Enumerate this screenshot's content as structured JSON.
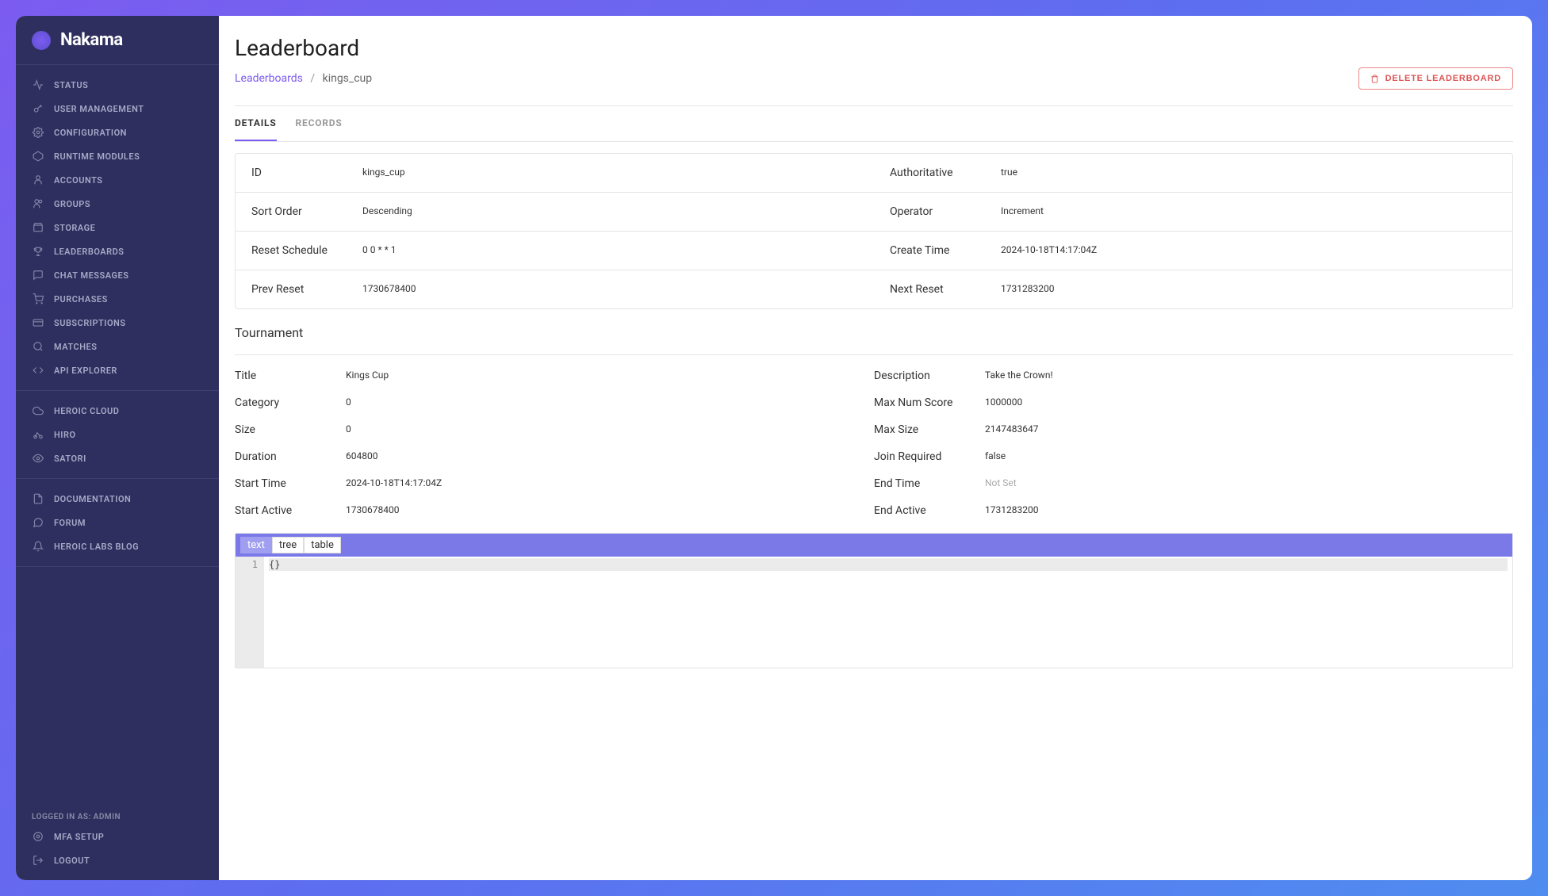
{
  "brand": "Nakama",
  "sidebar": {
    "main_items": [
      {
        "label": "Status",
        "icon": "activity"
      },
      {
        "label": "User Management",
        "icon": "key"
      },
      {
        "label": "Configuration",
        "icon": "gear"
      },
      {
        "label": "Runtime Modules",
        "icon": "hex"
      },
      {
        "label": "Accounts",
        "icon": "user"
      },
      {
        "label": "Groups",
        "icon": "users"
      },
      {
        "label": "Storage",
        "icon": "box"
      },
      {
        "label": "Leaderboards",
        "icon": "trophy"
      },
      {
        "label": "Chat Messages",
        "icon": "chat"
      },
      {
        "label": "Purchases",
        "icon": "cart"
      },
      {
        "label": "Subscriptions",
        "icon": "card"
      },
      {
        "label": "Matches",
        "icon": "flag"
      },
      {
        "label": "API Explorer",
        "icon": "code"
      }
    ],
    "product_items": [
      {
        "label": "Heroic Cloud",
        "icon": "cloud"
      },
      {
        "label": "Hiro",
        "icon": "bike"
      },
      {
        "label": "Satori",
        "icon": "eye"
      }
    ],
    "help_items": [
      {
        "label": "Documentation",
        "icon": "doc"
      },
      {
        "label": "Forum",
        "icon": "forum"
      },
      {
        "label": "Heroic Labs Blog",
        "icon": "bell"
      }
    ],
    "footer": {
      "logged_in": "Logged in as: admin",
      "mfa": "MFA Setup",
      "logout": "Logout"
    }
  },
  "page": {
    "title": "Leaderboard",
    "breadcrumb": {
      "parent": "Leaderboards",
      "current": "kings_cup"
    },
    "delete_button": "DELETE LEADERBOARD",
    "tabs": [
      {
        "label": "DETAILS",
        "active": true
      },
      {
        "label": "RECORDS",
        "active": false
      }
    ]
  },
  "details": {
    "id_label": "ID",
    "id_value": "kings_cup",
    "auth_label": "Authoritative",
    "auth_value": "true",
    "sort_label": "Sort Order",
    "sort_value": "Descending",
    "operator_label": "Operator",
    "operator_value": "Increment",
    "reset_sched_label": "Reset Schedule",
    "reset_sched_value": "0 0 * * 1",
    "create_time_label": "Create Time",
    "create_time_value": "2024-10-18T14:17:04Z",
    "prev_reset_label": "Prev Reset",
    "prev_reset_value": "1730678400",
    "next_reset_label": "Next Reset",
    "next_reset_value": "1731283200"
  },
  "tournament": {
    "section_title": "Tournament",
    "title_label": "Title",
    "title_value": "Kings Cup",
    "desc_label": "Description",
    "desc_value": "Take the Crown!",
    "category_label": "Category",
    "category_value": "0",
    "max_score_label": "Max Num Score",
    "max_score_value": "1000000",
    "size_label": "Size",
    "size_value": "0",
    "max_size_label": "Max Size",
    "max_size_value": "2147483647",
    "duration_label": "Duration",
    "duration_value": "604800",
    "join_req_label": "Join Required",
    "join_req_value": "false",
    "start_time_label": "Start Time",
    "start_time_value": "2024-10-18T14:17:04Z",
    "end_time_label": "End Time",
    "end_time_value": "Not Set",
    "start_active_label": "Start Active",
    "start_active_value": "1730678400",
    "end_active_label": "End Active",
    "end_active_value": "1731283200"
  },
  "editor": {
    "modes": [
      "text",
      "tree",
      "table"
    ],
    "active_mode": "text",
    "line_no": "1",
    "content": "{}"
  }
}
